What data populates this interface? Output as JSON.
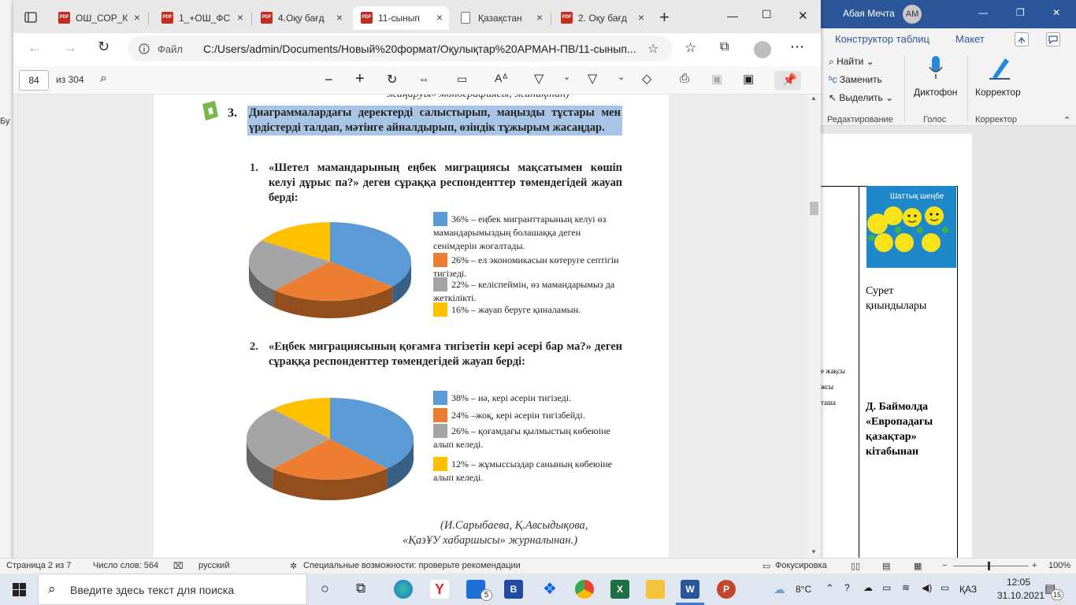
{
  "word": {
    "user_name": "Абая Мечта",
    "user_initials": "АМ",
    "ribbon_tabs": [
      "Конструктор таблиц",
      "Макет"
    ],
    "ribbon": {
      "find": "Найти",
      "replace": "Заменить",
      "select": "Выделить",
      "dictation": "Диктофон",
      "editor": "Корректор",
      "group_editing": "Редактирование",
      "group_voice": "Голос",
      "group_editor": "Корректор"
    },
    "left_strip": "Бу",
    "doc": {
      "cell_caption": "Сурет қиындылары",
      "cell_bold": "Д. Баймолда «Европадағы қазақтар» кітабынан",
      "image_caption": "Шаттық шеңбе",
      "fragment1": "е жақсы",
      "fragment2": "жсы",
      "fragment3": "таша"
    },
    "status": {
      "page": "Страница 2 из 7",
      "words": "Число слов: 564",
      "language": "русский",
      "accessibility": "Специальные возможности: проверьте рекомендации",
      "focus": "Фокусировка",
      "zoom": "100%"
    }
  },
  "browser": {
    "tabs": [
      {
        "label": "ОШ_СОР_К",
        "icon": "pdf"
      },
      {
        "label": "1_+ОШ_ФС",
        "icon": "pdf"
      },
      {
        "label": "4.Оқу бағд",
        "icon": "pdf"
      },
      {
        "label": "11-сынып",
        "icon": "pdf",
        "active": true
      },
      {
        "label": "Қазақстан",
        "icon": "page"
      },
      {
        "label": "2. Оқу бағд",
        "icon": "pdf"
      }
    ],
    "address_prefix": "Файл",
    "url": "C:/Users/admin/Documents/Новый%20формат/Оқулықтар%20АРМАН-ПВ/11-сынып...",
    "page_current": "84",
    "page_total": "из 304"
  },
  "pdf": {
    "top_cut": "жаңаруы» монографиясы, жинақтан)",
    "task_number": "3.",
    "task_text": "Диаграммалардағы деректерді салыстырып, маңызды тұстары мен үрдістерді талдап, мәтінге айналдырып, өзіндік тұжырым жасаңдар.",
    "q1_number": "1.",
    "q1_text": "«Шетел мамандарының еңбек миграциясы мақсатымен көшіп келуі дұрыс па?» деген сұраққа респонденттер төмендегідей жауап берді:",
    "q2_number": "2.",
    "q2_text": "«Еңбек миграциясының қоғамға тигізетін кері әсері бар ма?» деген сұраққа респонденттер төмендегідей жауап берді:",
    "source_line1": "(И.Сарыбаева, Қ.Авсыдықова,",
    "source_line2": "«ҚазҰУ хабаршысы» журналынан.)"
  },
  "taskbar": {
    "search_placeholder": "Введите здесь текст для поиска",
    "temperature": "8°C",
    "language": "ҚАЗ",
    "time": "12:05",
    "date": "31.10.2021",
    "notifications": "15",
    "mail_badge": "5"
  },
  "colors": {
    "blue": "#5b9bd5",
    "orange": "#ed7d31",
    "gray": "#a5a5a5",
    "yellow": "#ffc000",
    "highlight": "#a9c5e6",
    "word_accent": "#2b579a"
  },
  "chart_data": [
    {
      "type": "pie",
      "categories": [
        "еңбек мигранттарының келуі өз мамандарымыздың болашаққа деген сенімдерін жоғалтады.",
        "ел экономикасын көтеруге септігін тигізеді.",
        "келіспеймін, өз мамандарымыз да жеткілікті.",
        "жауап беруге қиналамын."
      ],
      "values": [
        36,
        26,
        22,
        16
      ],
      "labels": [
        "36% – еңбек мигранттарының келуі өз мамандарымыздың болашаққа деген сенімдерін жоғалтады.",
        "26% – ел экономикасын көтеруге септігін тигізеді.",
        "22% – келіспеймін, өз мамандарымыз да жеткілікті.",
        "16% – жауап беруге қиналамын."
      ],
      "colors": [
        "#5b9bd5",
        "#ed7d31",
        "#a5a5a5",
        "#ffc000"
      ]
    },
    {
      "type": "pie",
      "categories": [
        "иә, кері әсерін тигізеді.",
        "жоқ, кері әсерін тигізбейді.",
        "қоғамдағы қылмыстың көбеюіне алып келеді.",
        "жұмыссыздар санының көбеюіне алып келеді."
      ],
      "values": [
        38,
        24,
        26,
        12
      ],
      "labels": [
        "38% – иә, кері әсерін тигізеді.",
        "24% –жоқ, кері әсерін тигізбейді.",
        "26% – қоғамдағы қылмыстың көбеюіне алып келеді.",
        "12% – жұмыссыздар санының көбеюіне алып келеді."
      ],
      "colors": [
        "#5b9bd5",
        "#ed7d31",
        "#a5a5a5",
        "#ffc000"
      ]
    }
  ]
}
